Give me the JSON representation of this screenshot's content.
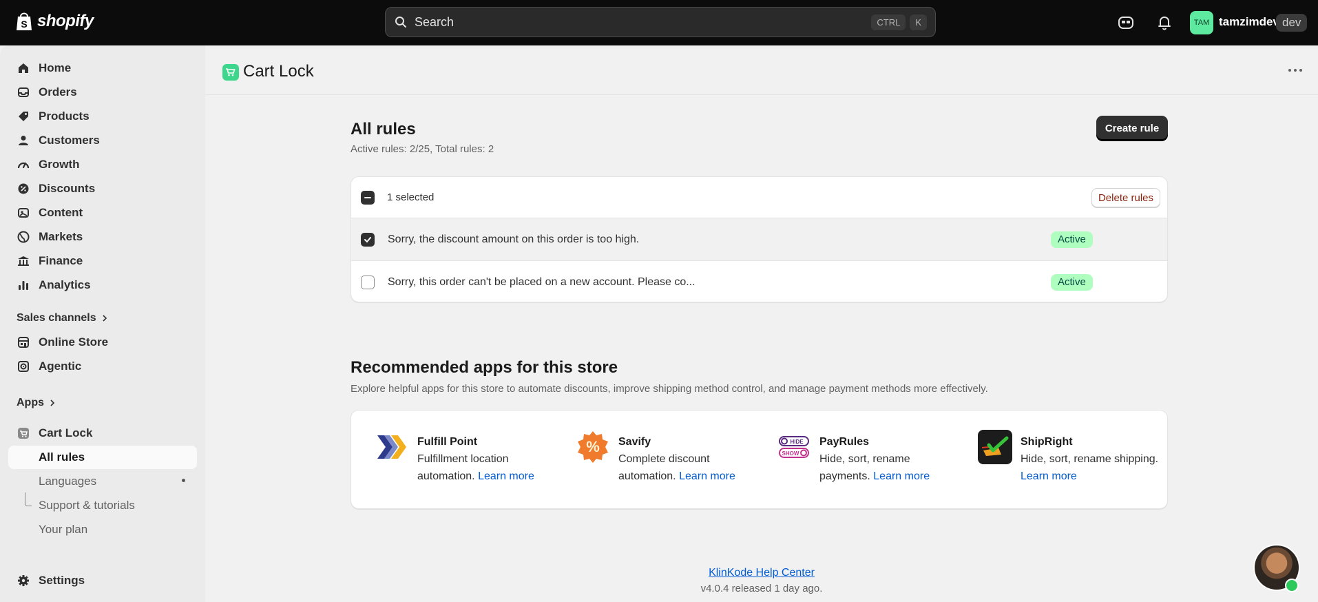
{
  "topbar": {
    "brand": "shopify",
    "search_placeholder": "Search",
    "shortcut_keys": [
      "CTRL",
      "K"
    ],
    "user_initials": "TAM",
    "user_name": "tamzimdev",
    "env_badge": "dev"
  },
  "sidebar": {
    "nav": [
      {
        "label": "Home",
        "icon": "home-icon"
      },
      {
        "label": "Orders",
        "icon": "inbox-icon"
      },
      {
        "label": "Products",
        "icon": "tag-icon"
      },
      {
        "label": "Customers",
        "icon": "person-icon"
      },
      {
        "label": "Growth",
        "icon": "gauge-icon"
      },
      {
        "label": "Discounts",
        "icon": "discount-icon"
      },
      {
        "label": "Content",
        "icon": "image-icon"
      },
      {
        "label": "Markets",
        "icon": "globe-icon"
      },
      {
        "label": "Finance",
        "icon": "bank-icon"
      },
      {
        "label": "Analytics",
        "icon": "bar-chart-icon"
      }
    ],
    "sales_channels_label": "Sales channels",
    "channels": [
      {
        "label": "Online Store",
        "icon": "store-icon"
      },
      {
        "label": "Agentic",
        "icon": "robot-icon"
      }
    ],
    "apps_label": "Apps",
    "app": {
      "label": "Cart Lock",
      "icon": "cart-lock-icon"
    },
    "app_subitems": [
      "All rules",
      "Languages",
      "Support & tutorials",
      "Your plan"
    ],
    "settings_label": "Settings"
  },
  "app_header": {
    "title": "Cart Lock"
  },
  "rules": {
    "title": "All rules",
    "summary": "Active rules: 2/25, Total rules: 2",
    "create_button": "Create rule",
    "selected_text": "1 selected",
    "delete_button": "Delete rules",
    "items": [
      {
        "text": "Sorry, the discount amount on this order is too high.",
        "status": "Active",
        "checked": true
      },
      {
        "text": "Sorry, this order can't be placed on a new account. Please co...",
        "status": "Active",
        "checked": false
      }
    ]
  },
  "recommended": {
    "title": "Recommended apps for this store",
    "subtitle": "Explore helpful apps for this store to automate discounts, improve shipping method control, and manage payment methods more effectively.",
    "apps": [
      {
        "name": "Fulfill Point",
        "desc": "Fulfillment location automation.",
        "link": "Learn more"
      },
      {
        "name": "Savify",
        "desc": "Complete discount automation.",
        "link": "Learn more"
      },
      {
        "name": "PayRules",
        "desc": "Hide, sort, rename payments.",
        "link": "Learn more"
      },
      {
        "name": "ShipRight",
        "desc": "Hide, sort, rename shipping.",
        "link": "Learn more"
      }
    ],
    "payrules_icon_words": [
      "HIDE",
      "SHOW"
    ]
  },
  "footer": {
    "help_link": "KlinKode Help Center",
    "version": "v4.0.4 released 1 day ago."
  },
  "colors": {
    "topbar_bg": "#0c0c0c",
    "accent_green": "#3dd68c",
    "badge_bg": "#affebf",
    "badge_text": "#014b40",
    "link_blue": "#005bd3",
    "primary_button": "#303030",
    "critical_text": "#8e1f0b"
  }
}
